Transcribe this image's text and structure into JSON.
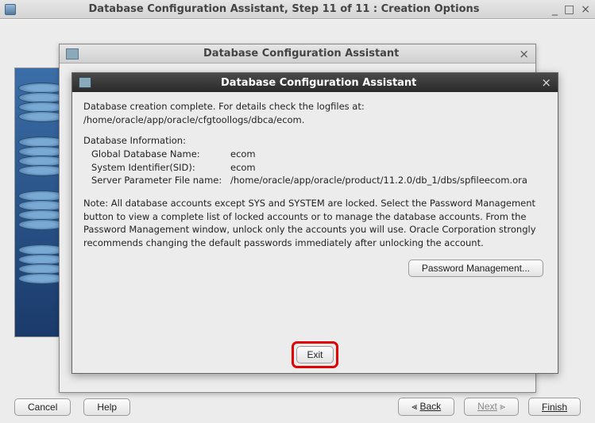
{
  "outer": {
    "title": "Database Configuration Assistant, Step 11 of 11 : Creation Options",
    "minimize": "_",
    "maximize": "□",
    "close": "×"
  },
  "mid": {
    "title": "Database Configuration Assistant",
    "close": "×"
  },
  "inner": {
    "title": "Database Configuration Assistant",
    "close": "×",
    "line1": "Database creation complete. For details check the logfiles at:",
    "line2": " /home/oracle/app/oracle/cfgtoollogs/dbca/ecom.",
    "info_header": "Database Information:",
    "rows": [
      {
        "label": "Global Database Name:",
        "value": "ecom"
      },
      {
        "label": "System Identifier(SID):",
        "value": "ecom"
      },
      {
        "label": "Server Parameter File name:",
        "value": "/home/oracle/app/oracle/product/11.2.0/db_1/dbs/spfileecom.ora"
      }
    ],
    "note": "Note: All database accounts except SYS and SYSTEM are locked. Select the Password Management button to view a complete list of locked accounts or to manage the database accounts. From the Password Management window, unlock only the accounts you will use. Oracle Corporation strongly recommends changing the default passwords immediately after unlocking the account.",
    "pwd_mgmt": "Password Management...",
    "exit": "Exit"
  },
  "bottom": {
    "cancel": "Cancel",
    "help": "Help",
    "back": "Back",
    "next": "Next",
    "finish": "Finish",
    "back_arrow": "⪡",
    "next_arrow": "⪢"
  },
  "ghost": {
    "b1": "...",
    "b2": "...",
    "b3": "..."
  }
}
